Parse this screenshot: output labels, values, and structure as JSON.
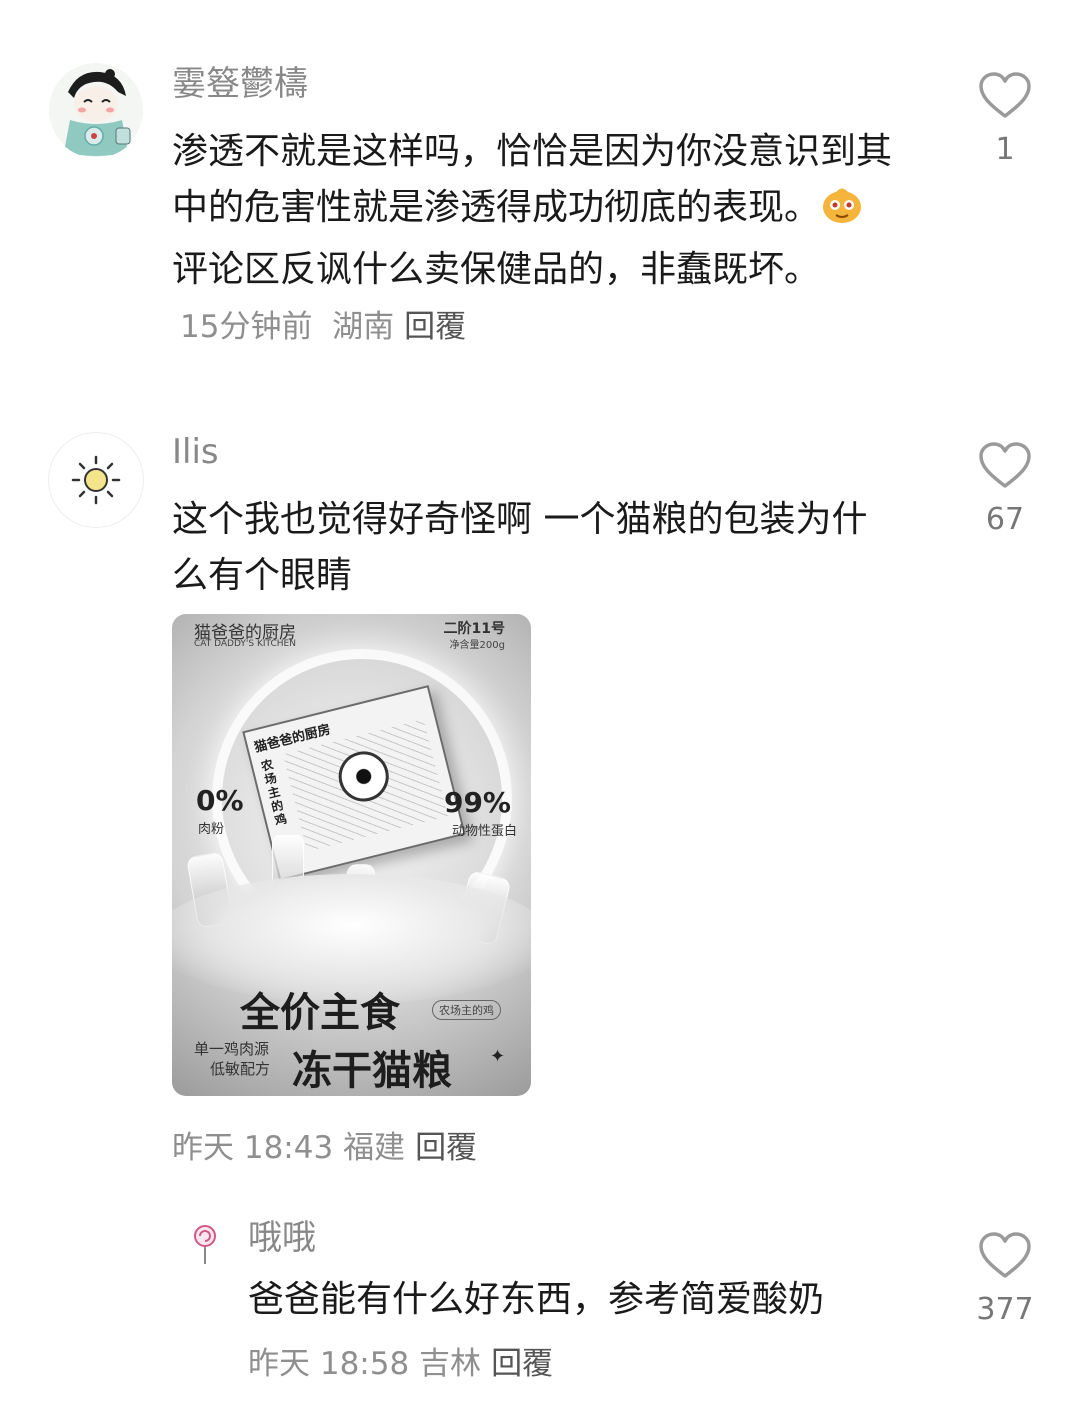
{
  "comments": [
    {
      "username": "霎簦鬱檮",
      "text_before_emoji": "渗透不就是这样吗，恰恰是因为你没意识到其中的危害性就是渗透得成功彻底的表现。",
      "text_after_emoji": "评论区反讽什么卖保健品的，非蠢既坏。",
      "time": "15分钟前",
      "location": "湖南",
      "reply_label": "回覆",
      "like_count": "1",
      "avatar_icon": "cartoon-avatar-icon"
    },
    {
      "username": "Ilis",
      "text": "这个我也觉得好奇怪啊 一个猫粮的包装为什么有个眼睛",
      "time": "昨天 18:43",
      "location": "福建",
      "reply_label": "回覆",
      "like_count": "67",
      "avatar_icon": "sun-icon",
      "image": {
        "brand_cn": "猫爸爸的厨房",
        "brand_en": "CAT DADDY'S KITCHEN",
        "stage": "二阶11号",
        "net_weight": "净含量200g",
        "package_brand": "猫爸爸的厨房",
        "package_sub": "农场主的鸡",
        "left_pct": "0%",
        "left_pct_label": "肉粉",
        "right_pct": "99%",
        "right_pct_label": "动物性蛋白",
        "headline1": "全价主食",
        "tag": "农场主的鸡",
        "headline2": "冻干猫粮",
        "small1": "单一鸡肉源",
        "small2": "低敏配方",
        "spark": "✦"
      }
    },
    {
      "username": "哦哦",
      "text": "爸爸能有什么好东西，参考简爱酸奶",
      "time": "昨天 18:58",
      "location": "吉林",
      "reply_label": "回覆",
      "like_count": "377",
      "avatar_icon": "lollipop-icon"
    }
  ],
  "colors": {
    "text": "#1a1a1a",
    "username": "#888888",
    "meta": "#8f8f8f",
    "icon": "#9a9a9a"
  }
}
